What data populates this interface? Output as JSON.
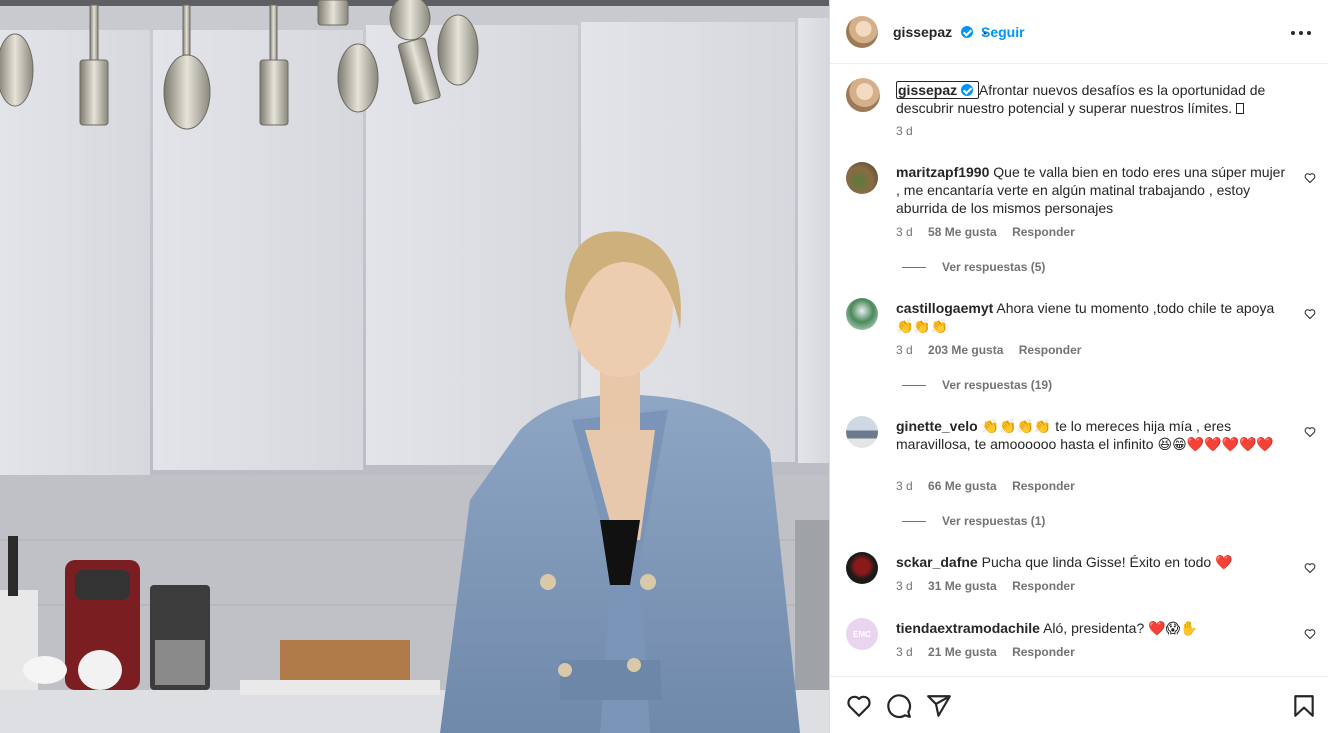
{
  "post": {
    "author": "gissepaz",
    "follow_label": "Seguir",
    "separator": "•",
    "caption": "Afrontar nuevos desafíos es la oportunidad de descubrir nuestro potencial y superar nuestros límites. ",
    "caption_time": "3 d"
  },
  "comments": [
    {
      "user": "maritzapf1990",
      "text": "Que te valla bien en todo eres una súper mujer , me encantaría verte en algún matinal trabajando , estoy aburrida de los mismos personajes",
      "time": "3 d",
      "likes": "58 Me gusta",
      "reply": "Responder",
      "view_replies": "Ver respuestas (5)"
    },
    {
      "user": "castillogaemyt",
      "text": "Ahora viene tu momento ,todo chile te apoya",
      "emoji": "👏👏👏",
      "time": "3 d",
      "likes": "203 Me gusta",
      "reply": "Responder",
      "view_replies": "Ver respuestas (19)"
    },
    {
      "user": "ginette_velo",
      "emoji_lead": "👏👏👏👏",
      "text": "te lo mereces hija mía , eres maravillosa, te amoooooo hasta el infinito",
      "emoji": "😆😁❤️❤️❤️❤️❤️",
      "time": "3 d",
      "likes": "66 Me gusta",
      "reply": "Responder",
      "view_replies": "Ver respuestas (1)"
    },
    {
      "user": "sckar_dafne",
      "text": "Pucha que linda Gisse! Éxito en todo",
      "emoji": "❤️",
      "time": "3 d",
      "likes": "31 Me gusta",
      "reply": "Responder"
    },
    {
      "user": "tiendaextramodachile",
      "avatar_text": "EMC",
      "text": "Aló, presidenta?",
      "emoji": "❤️😱✋",
      "time": "3 d",
      "likes": "21 Me gusta",
      "reply": "Responder"
    }
  ],
  "icons": [
    "heart-icon",
    "comment-icon",
    "share-icon",
    "save-icon",
    "more-icon",
    "verified-icon"
  ],
  "colors": {
    "link": "#0095f6",
    "muted": "#737373",
    "text": "#262626",
    "heart": "#e0182d"
  }
}
